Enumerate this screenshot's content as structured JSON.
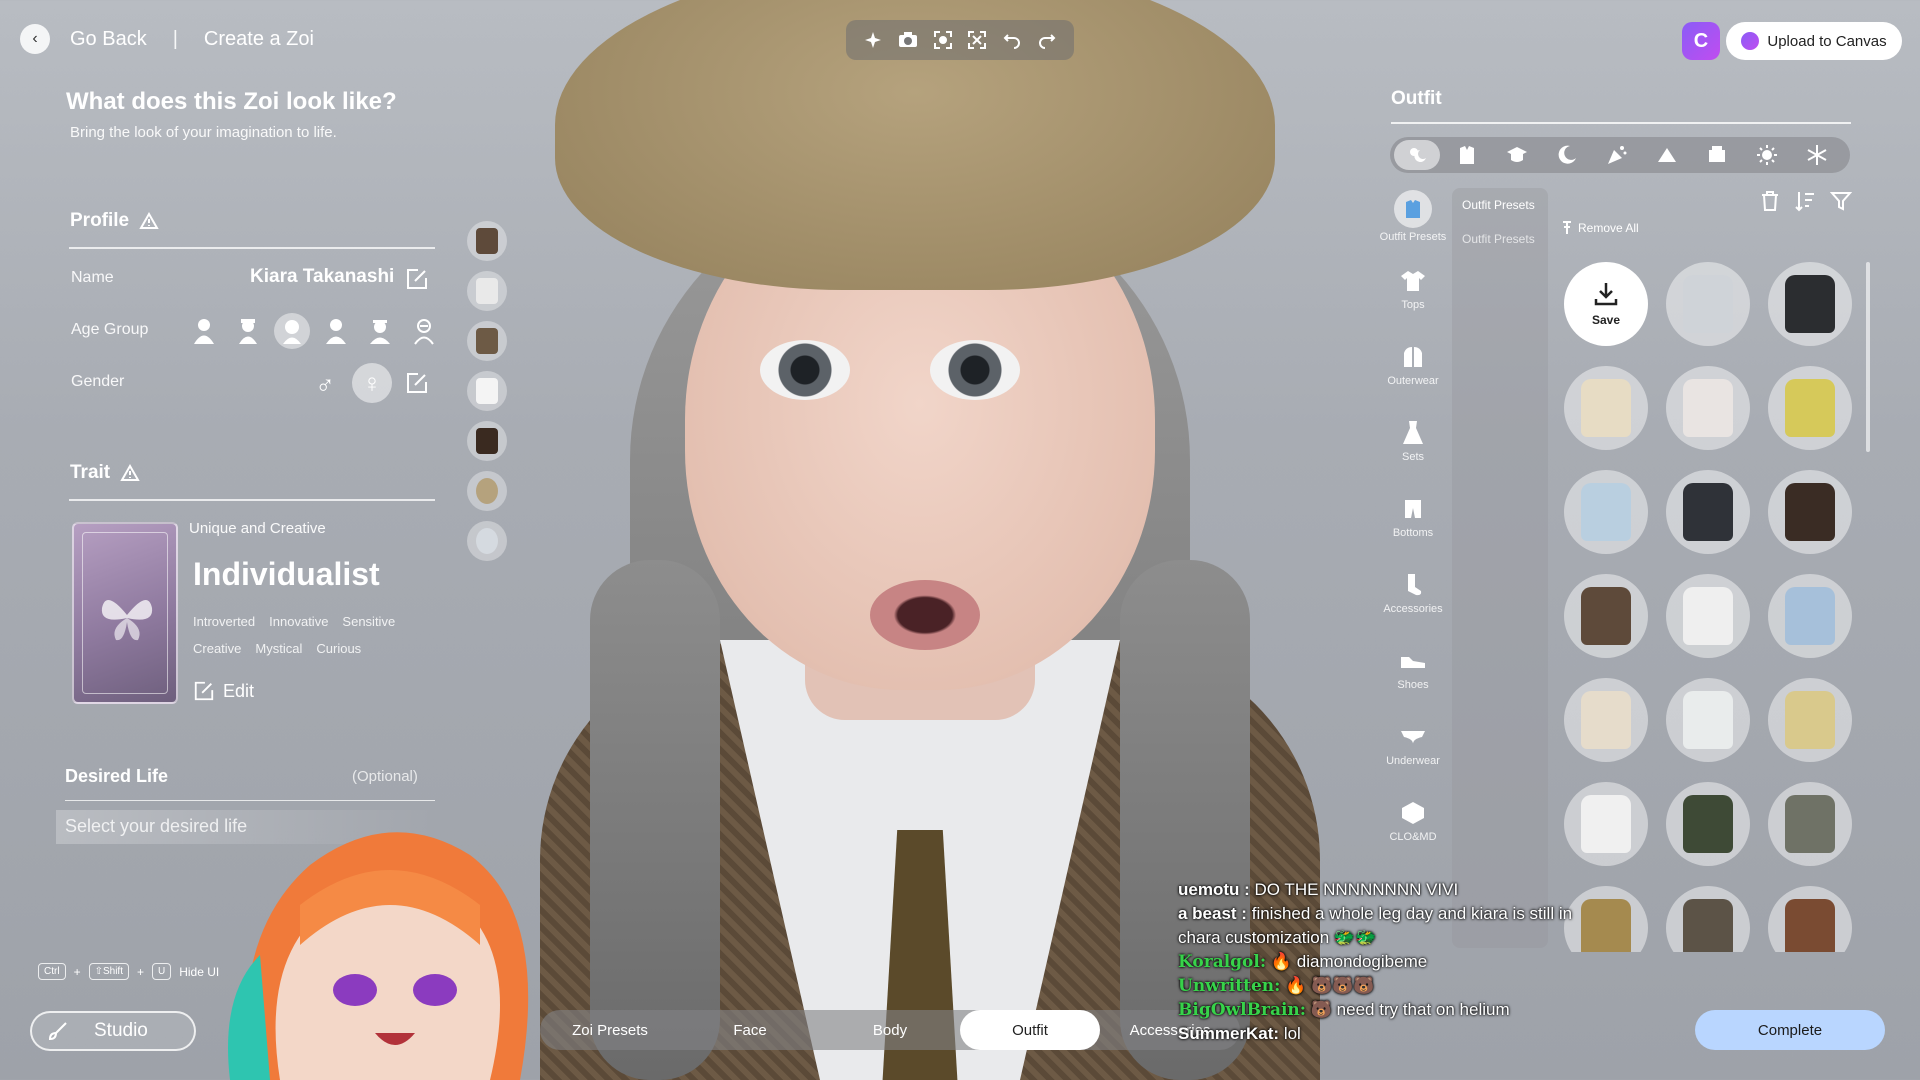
{
  "header": {
    "back_label": "Go Back",
    "separator": "|",
    "page_label": "Create a Zoi",
    "toolbar_icons": [
      "sparkle-icon",
      "camera-icon",
      "frame-icon",
      "focus-icon",
      "undo-icon",
      "redo-icon"
    ],
    "upload_label": "Upload to Canvas"
  },
  "left": {
    "title": "What does this Zoi look like?",
    "subtitle": "Bring the look of your imagination to life.",
    "profile": {
      "heading": "Profile",
      "name_label": "Name",
      "name_value": "Kiara Takanashi",
      "age_label": "Age Group",
      "age_icons": [
        "infant-icon",
        "child-icon",
        "teen-icon",
        "young-adult-icon",
        "adult-icon",
        "elder-icon"
      ],
      "age_selected": 2,
      "gender_label": "Gender",
      "gender_male_glyph": "♂",
      "gender_female_glyph": "♀"
    },
    "trait": {
      "heading": "Trait",
      "subtitle": "Unique and Creative",
      "name": "Individualist",
      "tags_row1": [
        "Introverted",
        "Innovative",
        "Sensitive"
      ],
      "tags_row2": [
        "Creative",
        "Mystical",
        "Curious"
      ],
      "edit_label": "Edit"
    },
    "desired_life": {
      "heading": "Desired Life",
      "optional": "(Optional)",
      "placeholder": "Select your desired life"
    },
    "hotkey": {
      "key1": "Ctrl",
      "plus": "+",
      "key2": "⇧Shift",
      "key3": "U",
      "label": "Hide UI"
    },
    "studio_label": "Studio"
  },
  "bottom_tabs": {
    "tabs": [
      "Zoi Presets",
      "Face",
      "Body",
      "Outfit",
      "Accessories"
    ],
    "active": 3
  },
  "complete_label": "Complete",
  "right": {
    "title": "Outfit",
    "categories": [
      "all-weather-icon",
      "formal-icon",
      "school-icon",
      "sleepwear-icon",
      "party-icon",
      "swim-icon",
      "sport-icon",
      "summer-icon",
      "winter-icon"
    ],
    "sidebar": [
      {
        "label": "Outfit Presets",
        "icon": "outfit-presets-icon"
      },
      {
        "label": "Tops",
        "icon": "shirt-icon"
      },
      {
        "label": "Outerwear",
        "icon": "jacket-icon"
      },
      {
        "label": "Sets",
        "icon": "dress-icon"
      },
      {
        "label": "Bottoms",
        "icon": "pants-icon"
      },
      {
        "label": "Accessories",
        "icon": "sock-icon"
      },
      {
        "label": "Shoes",
        "icon": "shoe-icon"
      },
      {
        "label": "Underwear",
        "icon": "underwear-icon"
      },
      {
        "label": "CLO&MD",
        "icon": "clo-icon"
      }
    ],
    "sub_items": [
      "Outfit Presets",
      "Outfit Presets"
    ],
    "remove_all": "Remove All",
    "save_label": "Save",
    "item_colors": [
      "#cfd3d8",
      "#2b2d30",
      "#e7dcc4",
      "#e9e4e2",
      "#d6c95a",
      "#b9cfe0",
      "#2f3238",
      "#3a2c24",
      "#5e4a3a",
      "#efefef",
      "#a6c0da",
      "#e6dccb",
      "#e9ecec",
      "#d9c98c",
      "#f0f0f0",
      "#3e4a36",
      "#6f7266",
      "#a58a4f",
      "#5c5347",
      "#7a4b32"
    ]
  },
  "chat": [
    {
      "user": "uemotu :",
      "text": "DO THE NNNNNNNN VIVI",
      "style": "u"
    },
    {
      "user": "a beast :",
      "text": "finished a whole leg day and kiara is still in chara customization 🐲🐲",
      "style": "u"
    },
    {
      "user": "Koralgol:",
      "text": "🔥 diamondogibeme",
      "style": "g"
    },
    {
      "user": "Unwritten:",
      "text": "🔥 🐻🐻🐻",
      "style": "g"
    },
    {
      "user": "BigOwlBrain:",
      "text": "🐻 need try that on helium",
      "style": "g"
    },
    {
      "user": "SummerKat:",
      "text": "lol",
      "style": "u"
    }
  ]
}
